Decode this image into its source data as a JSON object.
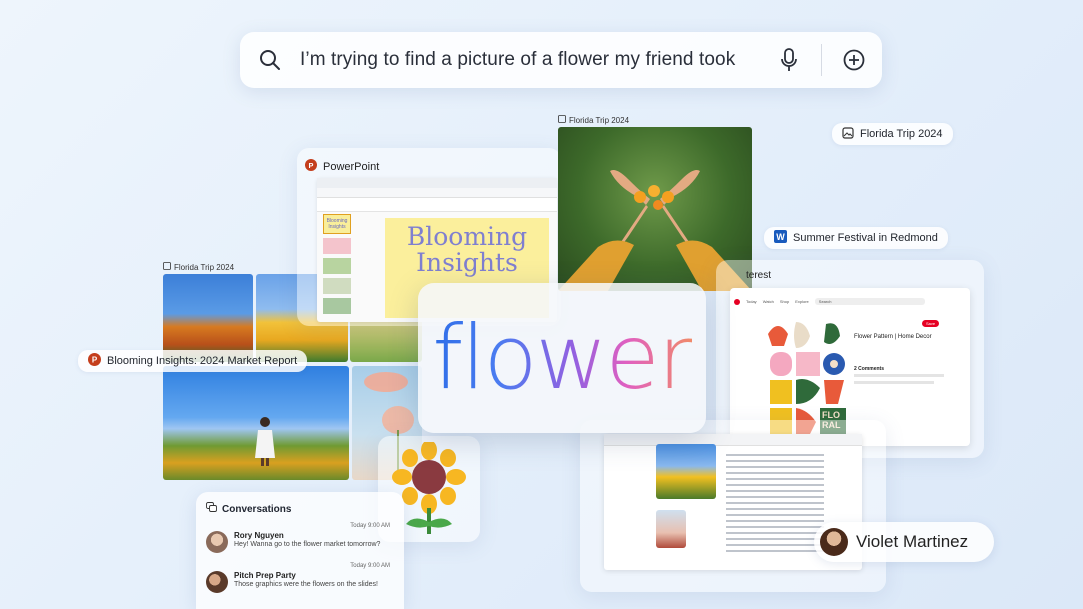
{
  "search": {
    "query": "I’m trying to find a picture of a flower my friend took"
  },
  "hero": {
    "word": "flower"
  },
  "chips": {
    "florida_trip_right": "Florida Trip 2024",
    "summer_festival": "Summer Festival in Redmond",
    "blooming_report": "Blooming Insights: 2024 Market Report",
    "florida_trip_top": "Florida Trip 2024",
    "florida_trip_left": "Florida Trip 2024"
  },
  "powerpoint": {
    "app_name": "PowerPoint",
    "slide_title_line1": "Blooming",
    "slide_title_line2": "Insights",
    "thumb_title_line1": "Blooming",
    "thumb_title_line2": "Insights"
  },
  "pinterest": {
    "app_name_partial": "terest",
    "nav": [
      "Today",
      "Watch",
      "Shop",
      "Explore"
    ],
    "search_placeholder": "Search",
    "pin_title": "Flower Pattern | Home Decor",
    "comments_heading": "2 Comments",
    "save_label": "Save",
    "art_text_line1": "FLO",
    "art_text_line2": "RAL"
  },
  "conversations": {
    "title": "Conversations",
    "messages": [
      {
        "time": "Today 9:00 AM",
        "name": "Rory Nguyen",
        "text": "Hey! Wanna go to the flower market tomorrow?"
      },
      {
        "time": "Today 9:00 AM",
        "name": "Pitch Prep Party",
        "text": "Those graphics were the flowers on the slides!"
      }
    ]
  },
  "person": {
    "name": "Violet Martinez"
  },
  "colors": {
    "accent_blue": "#2f6ee8",
    "accent_pink": "#e060c0",
    "powerpoint_red": "#c43e1c",
    "word_blue": "#185abd",
    "pinterest_red": "#e60023"
  }
}
